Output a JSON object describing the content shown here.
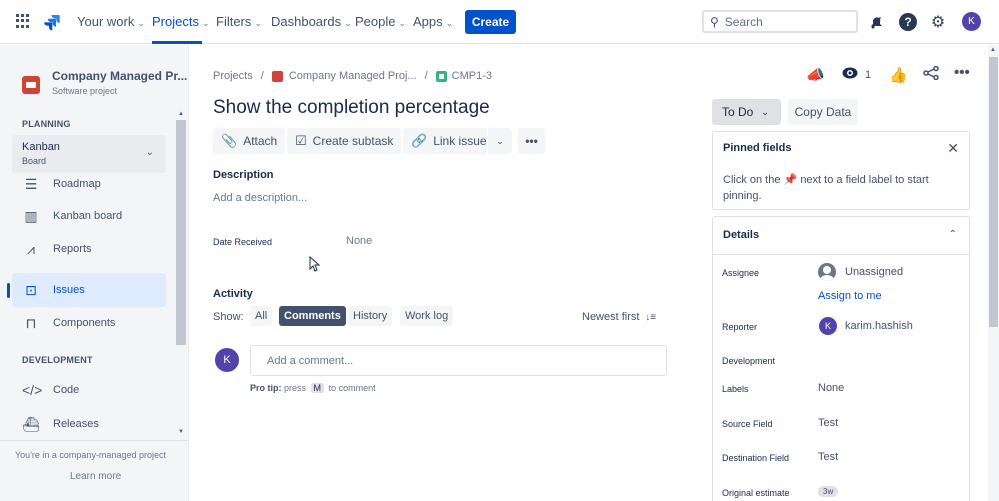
{
  "topnav": {
    "items": [
      {
        "label": "Your work",
        "active": false
      },
      {
        "label": "Projects",
        "active": true
      },
      {
        "label": "Filters",
        "active": false
      },
      {
        "label": "Dashboards",
        "active": false
      },
      {
        "label": "People",
        "active": false
      },
      {
        "label": "Apps",
        "active": false
      }
    ],
    "create_label": "Create",
    "search_placeholder": "Search",
    "user_initial": "K",
    "accent": "#0052cc"
  },
  "sidebar": {
    "project_name": "Company Managed Pr...",
    "project_type": "Software project",
    "planning_label": "PLANNING",
    "board_name": "Kanban",
    "board_type": "Board",
    "items": [
      {
        "label": "Roadmap",
        "icon": "roadmap-icon"
      },
      {
        "label": "Kanban board",
        "icon": "board-icon"
      },
      {
        "label": "Reports",
        "icon": "reports-icon"
      },
      {
        "label": "Issues",
        "icon": "issues-icon",
        "selected": true
      },
      {
        "label": "Components",
        "icon": "components-icon"
      }
    ],
    "development_label": "DEVELOPMENT",
    "dev_items": [
      {
        "label": "Code",
        "icon": "code-icon"
      },
      {
        "label": "Releases",
        "icon": "releases-icon"
      }
    ],
    "footer_text": "You're in a company-managed project",
    "learn_more": "Learn more"
  },
  "issue": {
    "breadcrumb": [
      "Projects",
      "Company Managed Proj...",
      "CMP1-3"
    ],
    "title": "Show the completion percentage",
    "actions": {
      "attach": "Attach",
      "create_subtask": "Create subtask",
      "link_issue": "Link issue"
    },
    "description_label": "Description",
    "description_placeholder": "Add a description...",
    "date_received_label": "Date Received",
    "date_received_value": "None",
    "activity_label": "Activity",
    "show_label": "Show:",
    "filters": [
      {
        "label": "All",
        "active": false
      },
      {
        "label": "Comments",
        "active": true
      },
      {
        "label": "History",
        "active": false
      },
      {
        "label": "Work log",
        "active": false
      }
    ],
    "sort_label": "Newest first",
    "comment_avatar": "K",
    "comment_placeholder": "Add a comment...",
    "pro_tip_bold": "Pro tip:",
    "pro_tip_press": "press",
    "pro_tip_key": "M",
    "pro_tip_rest": "to comment"
  },
  "right": {
    "watch_count": "1",
    "status": "To Do",
    "copy_data": "Copy Data",
    "pinned_title": "Pinned fields",
    "pinned_text_1": "Click on the",
    "pinned_text_2": "next to a field label to start pinning.",
    "details_title": "Details",
    "fields": {
      "assignee_label": "Assignee",
      "assignee_value": "Unassigned",
      "assign_to_me": "Assign to me",
      "reporter_label": "Reporter",
      "reporter_value": "karim.hashish",
      "reporter_initial": "K",
      "development_label": "Development",
      "labels_label": "Labels",
      "labels_value": "None",
      "source_label": "Source Field",
      "source_value": "Test",
      "destination_label": "Destination Field",
      "destination_value": "Test",
      "estimate_label": "Original estimate",
      "estimate_value": "3w"
    }
  }
}
